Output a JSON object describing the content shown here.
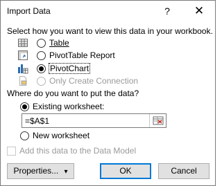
{
  "window": {
    "title": "Import Data",
    "help_glyph": "?",
    "close_glyph": "✕"
  },
  "view_section": {
    "heading": "Select how you want to view this data in your workbook.",
    "options": [
      {
        "label": "Table",
        "selected": false,
        "enabled": true,
        "icon": "table-icon"
      },
      {
        "label": "PivotTable Report",
        "selected": false,
        "enabled": true,
        "icon": "pivottable-icon"
      },
      {
        "label": "PivotChart",
        "selected": true,
        "enabled": true,
        "icon": "pivotchart-icon"
      },
      {
        "label": "Only Create Connection",
        "selected": false,
        "enabled": false,
        "icon": "connection-icon"
      }
    ]
  },
  "location_section": {
    "heading": "Where do you want to put the data?",
    "existing_label": "Existing worksheet:",
    "existing_selected": true,
    "range_value": "=$A$1",
    "new_label": "New worksheet",
    "new_selected": false
  },
  "data_model": {
    "label": "Add this data to the Data Model",
    "checked": false,
    "enabled": false
  },
  "buttons": {
    "properties": "Properties...",
    "properties_arrow": "▾",
    "ok": "OK",
    "cancel": "Cancel"
  },
  "colors": {
    "accent": "#0078d7",
    "disabled_text": "#9a9a9a",
    "button_face": "#e1e1e1"
  }
}
